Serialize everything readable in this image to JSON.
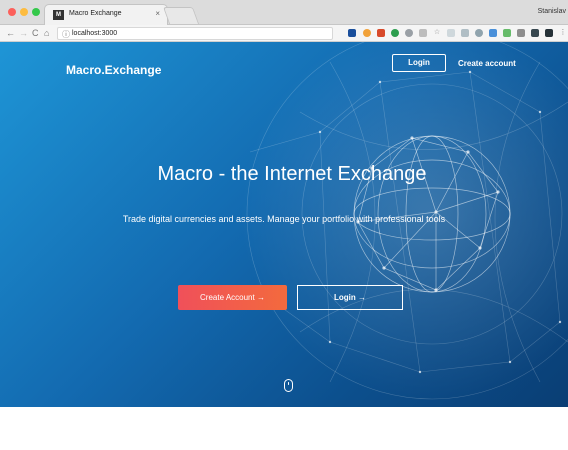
{
  "browser": {
    "tab_title": "Macro Exchange",
    "tab_favicon": "M",
    "tab_close": "×",
    "url": "localhost:3000",
    "profile": "Stanislav",
    "nav": {
      "back": "←",
      "forward": "→",
      "reload": "C",
      "home": "⌂",
      "info": "ⓘ"
    }
  },
  "header": {
    "brand": "Macro.Exchange",
    "login_label": "Login",
    "create_label": "Create account"
  },
  "hero": {
    "title": "Macro - the Internet Exchange",
    "subtitle": "Trade digital currencies and assets. Manage your portfolio with professional tools",
    "create_button": "Create Account  →",
    "login_button": "Login  →"
  },
  "colors": {
    "hero_top": "#1e95d6",
    "hero_bottom": "#0a3e74",
    "accent_button": "#f0505a"
  },
  "icons": [
    "scroll-mouse-icon",
    "globe-network-graphic"
  ]
}
